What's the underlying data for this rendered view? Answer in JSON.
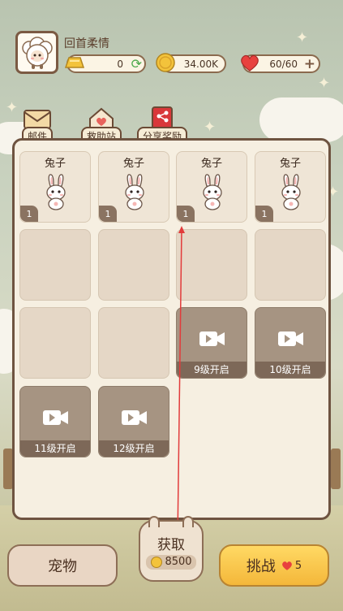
{
  "user": {
    "name": "回首柔情"
  },
  "currencies": {
    "gold_bars": "0",
    "coins": "34.00K",
    "hearts": "60/60"
  },
  "tabs": [
    {
      "label": "邮件",
      "icon": "envelope-icon"
    },
    {
      "label": "救助站",
      "icon": "house-heart-icon"
    },
    {
      "label": "分享奖励",
      "icon": "share-gift-icon"
    }
  ],
  "slots": {
    "pets": [
      {
        "name": "兔子",
        "count": "1",
        "icon": "bunny-icon"
      },
      {
        "name": "兔子",
        "count": "1",
        "icon": "bunny-icon"
      },
      {
        "name": "兔子",
        "count": "1",
        "icon": "bunny-icon"
      },
      {
        "name": "兔子",
        "count": "1",
        "icon": "bunny-icon"
      }
    ],
    "locked": [
      {
        "label": "9级开启",
        "icon": "video-icon"
      },
      {
        "label": "10级开启",
        "icon": "video-icon"
      },
      {
        "label": "11级开启",
        "icon": "video-icon"
      },
      {
        "label": "12级开启",
        "icon": "video-icon"
      }
    ]
  },
  "bottom": {
    "pet_button": "宠物",
    "get_button": "获取",
    "get_cost": "8500",
    "challenge_button": "挑战",
    "challenge_cost": "5"
  },
  "colors": {
    "panel_border": "#6e5340",
    "challenge_yellow": "#f4b73a",
    "heart_red": "#e8413e",
    "locked_slot": "#a69482"
  }
}
